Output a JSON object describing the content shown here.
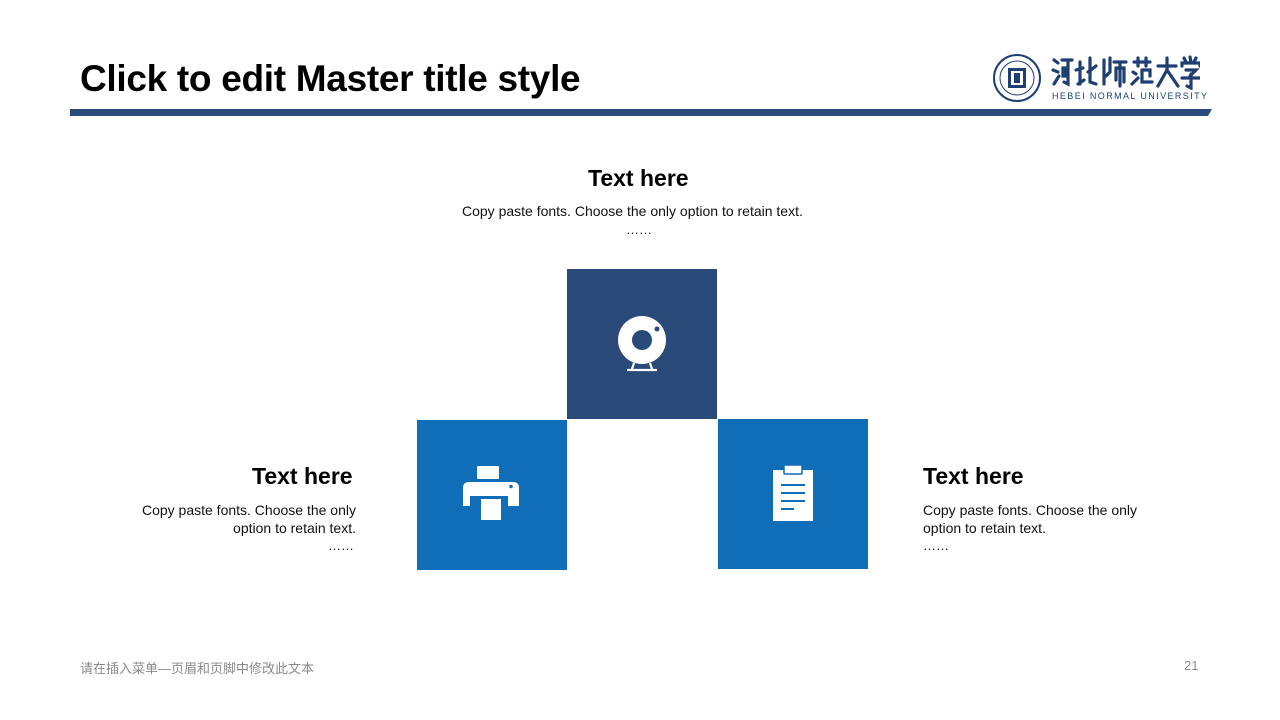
{
  "slide": {
    "title": "Click to edit Master title style",
    "page_number": "21",
    "footer_text": "请在插入菜单—页眉和页脚中修改此文本"
  },
  "logo": {
    "cn_text": "河北师范大学",
    "en_text": "HEBEI NORMAL UNIVERSITY"
  },
  "top_block": {
    "heading": "Text here",
    "body": "Copy paste fonts. Choose the only option to retain text.",
    "ellipsis": "……"
  },
  "left_block": {
    "heading": "Text here",
    "body_line1": "Copy paste fonts. Choose the only",
    "body_line2": "option to retain text.",
    "ellipsis": "……"
  },
  "right_block": {
    "heading": "Text here",
    "body_line1": "Copy paste fonts. Choose the only",
    "body_line2": "option to retain text.",
    "ellipsis": "……"
  },
  "tiles": [
    {
      "icon": "webcam-icon",
      "color": "#2a4a7a"
    },
    {
      "icon": "printer-icon",
      "color": "#106eb9"
    },
    {
      "icon": "clipboard-icon",
      "color": "#106eb9"
    }
  ],
  "colors": {
    "title_bar": "#284a7c",
    "dark_tile": "#2a4a7a",
    "blue_tile": "#106eb9",
    "footer_text": "#8a8a8a"
  }
}
